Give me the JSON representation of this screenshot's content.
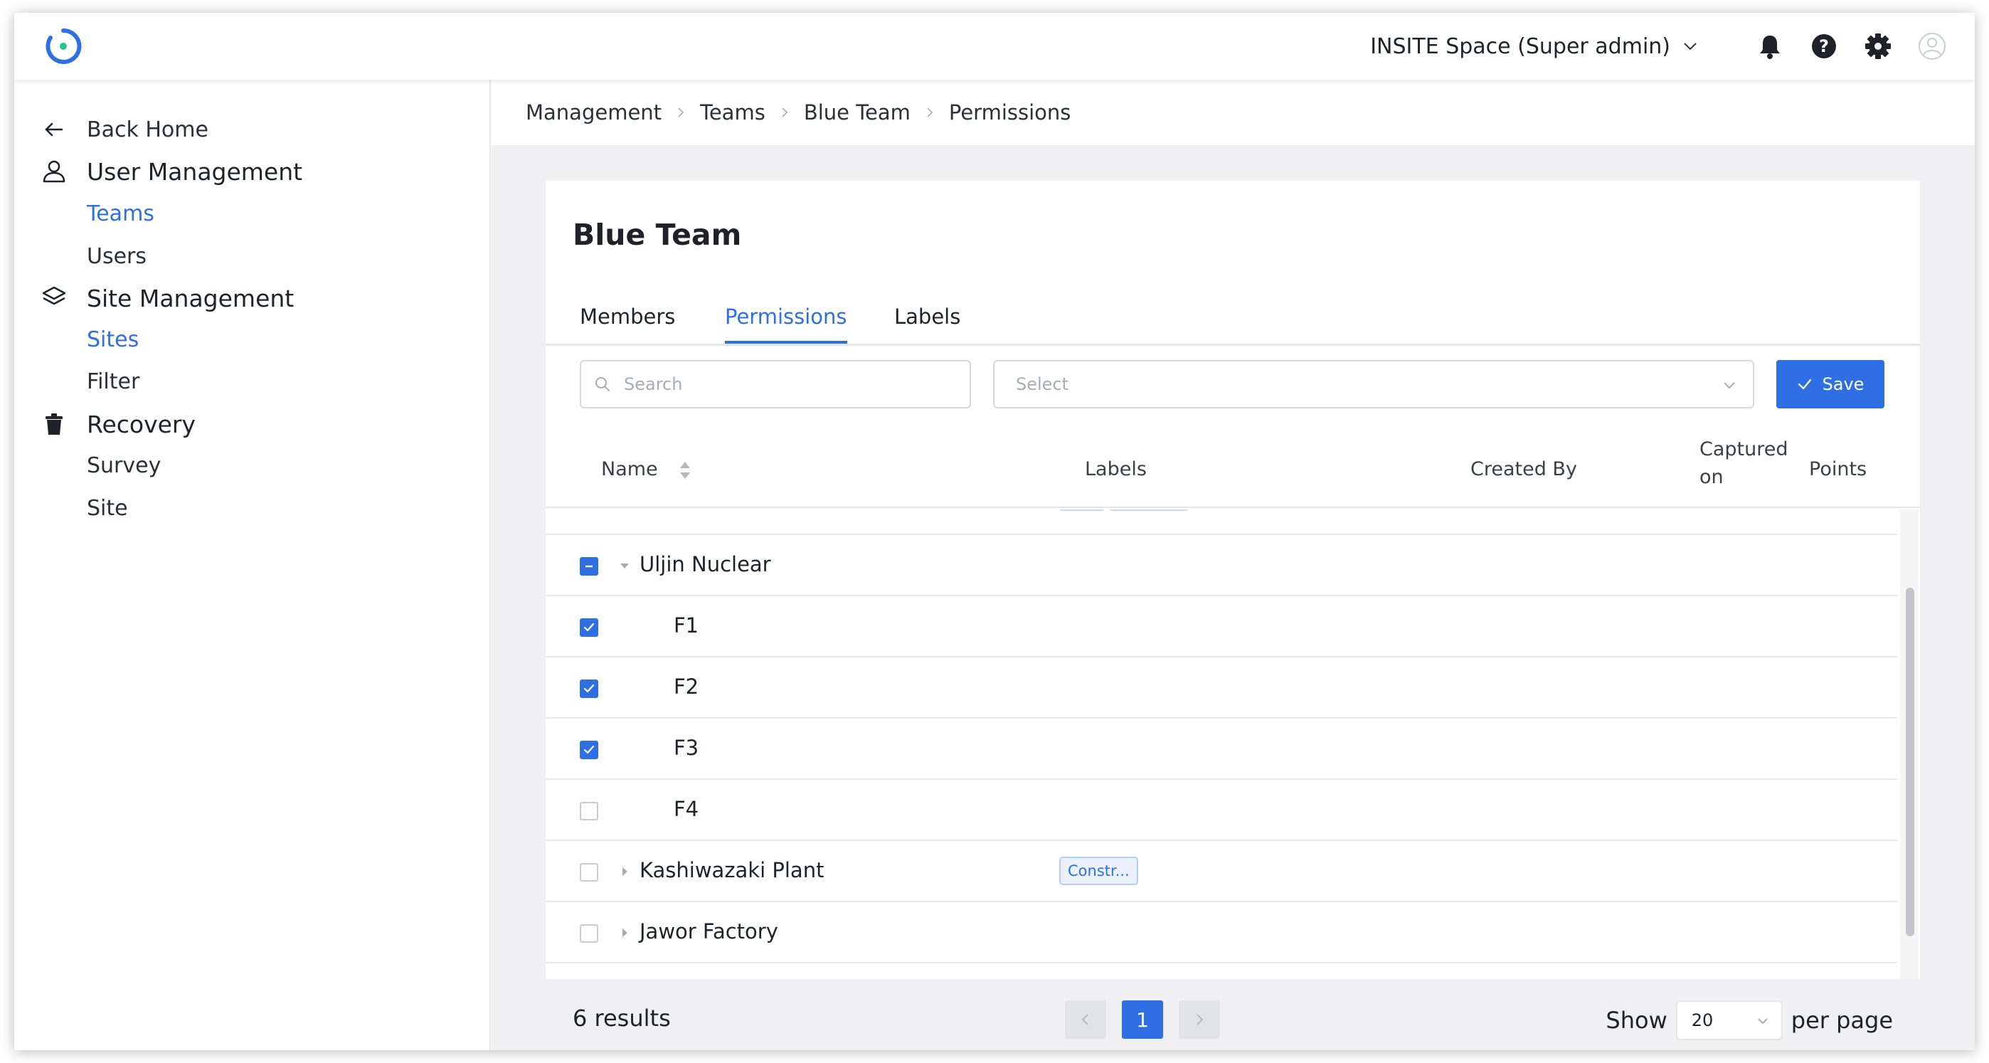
{
  "topbar": {
    "workspace": "INSITE Space (Super admin)",
    "icons": [
      "bell-icon",
      "help-icon",
      "gear-icon",
      "avatar"
    ]
  },
  "sidebar": {
    "back": "Back Home",
    "user_management": "User Management",
    "teams": "Teams",
    "users": "Users",
    "site_management": "Site Management",
    "sites": "Sites",
    "filter": "Filter",
    "recovery": "Recovery",
    "survey": "Survey",
    "site": "Site"
  },
  "breadcrumb": [
    "Management",
    "Teams",
    "Blue Team",
    "Permissions"
  ],
  "page": {
    "title": "Blue Team",
    "tabs": [
      "Members",
      "Permissions",
      "Labels"
    ],
    "active_tab": "Permissions"
  },
  "toolbar": {
    "search_placeholder": "Search",
    "select_placeholder": "Select",
    "save_label": "Save"
  },
  "table": {
    "headers": {
      "name": "Name",
      "labels": "Labels",
      "created_by": "Created By",
      "captured_on_1": "Captured",
      "captured_on_2": "on",
      "points": "Points"
    },
    "rows": [
      {
        "name": "Uljin Nuclear",
        "level": 0,
        "state": "indeterminate",
        "expanded": true,
        "label": ""
      },
      {
        "name": "F1",
        "level": 1,
        "state": "checked",
        "label": ""
      },
      {
        "name": "F2",
        "level": 1,
        "state": "checked",
        "label": ""
      },
      {
        "name": "F3",
        "level": 1,
        "state": "checked",
        "label": ""
      },
      {
        "name": "F4",
        "level": 1,
        "state": "unchecked",
        "label": ""
      },
      {
        "name": "Kashiwazaki Plant",
        "level": 0,
        "state": "unchecked",
        "expanded": false,
        "label": "Constr..."
      },
      {
        "name": "Jawor Factory",
        "level": 0,
        "state": "unchecked",
        "expanded": false,
        "label": ""
      }
    ]
  },
  "footer": {
    "results": "6 results",
    "current_page": "1",
    "show_label": "Show",
    "per_page_value": "20",
    "per_page_label": "per page"
  },
  "colors": {
    "accent": "#2f6fe4",
    "page_bg": "#f0f0f2",
    "border": "#e3e5ea"
  }
}
